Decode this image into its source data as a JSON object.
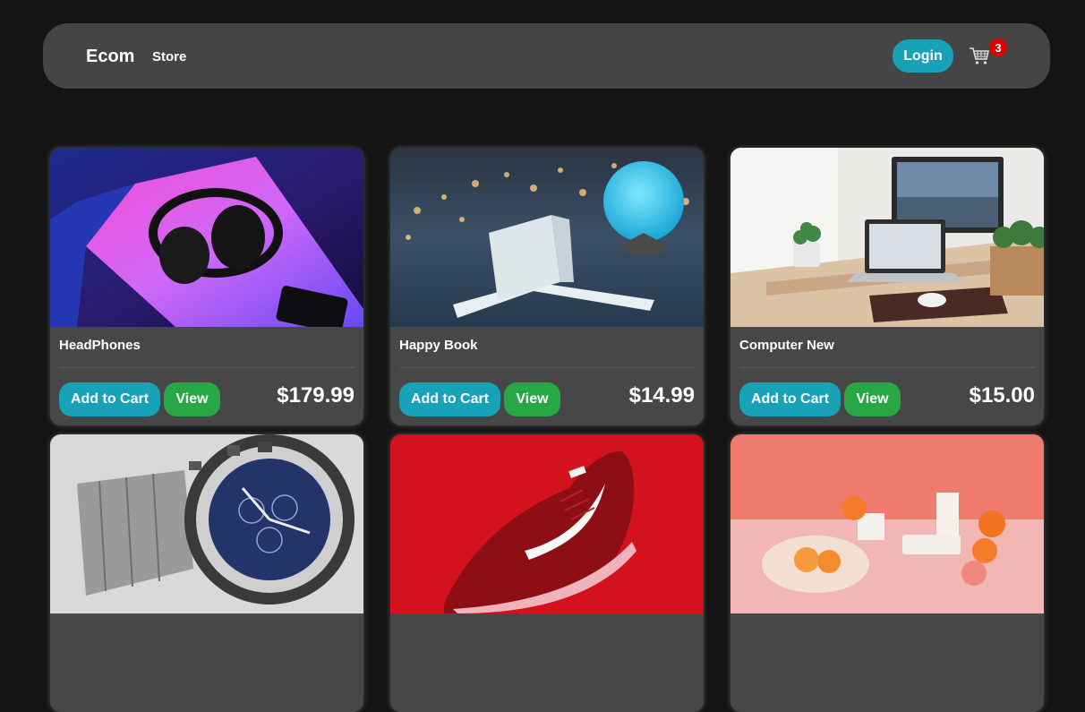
{
  "navbar": {
    "brand": "Ecom",
    "store_link": "Store",
    "login_label": "Login",
    "cart_count": "3",
    "cart_icon": "shopping-cart-icon"
  },
  "products": [
    {
      "title": "HeadPhones",
      "price": "$179.99",
      "add_label": "Add to Cart",
      "view_label": "View",
      "image": "headphones-photo"
    },
    {
      "title": "Happy Book",
      "price": "$14.99",
      "add_label": "Add to Cart",
      "view_label": "View",
      "image": "book-and-moon-lamp-photo"
    },
    {
      "title": "Computer New",
      "price": "$15.00",
      "add_label": "Add to Cart",
      "view_label": "View",
      "image": "desk-with-computer-photo"
    },
    {
      "image": "wristwatch-photo"
    },
    {
      "image": "red-sneaker-photo"
    },
    {
      "image": "grocery-still-life-photo"
    }
  ],
  "colors": {
    "background": "#141414",
    "navbar": "#454545",
    "card": "#474747",
    "info_button": "#17a2b8",
    "success_button": "#28a745",
    "badge": "#e00000"
  }
}
